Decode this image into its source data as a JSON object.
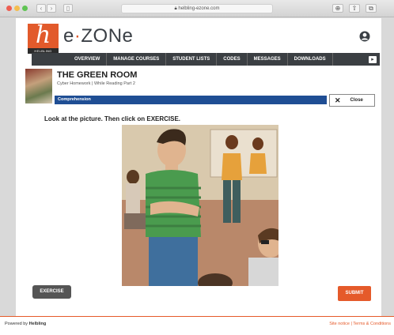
{
  "browser": {
    "url": "helbling-ezone.com",
    "colors": {
      "close": "#ee5e52",
      "minimize": "#f4bd4f",
      "maximize": "#5fc453"
    }
  },
  "header": {
    "logo_letter": "h",
    "logo_sub": "HELBLING",
    "brand_prefix": "e",
    "brand_dot": "·",
    "brand_suffix": "ZONe",
    "user_icon": "user-circle-icon"
  },
  "menu": {
    "items": [
      "OVERVIEW",
      "MANAGE COURSES",
      "STUDENT LISTS",
      "CODES",
      "MESSAGES",
      "DOWNLOADS"
    ]
  },
  "content": {
    "title": "THE GREEN ROOM",
    "subtitle": "Cyber Homework | While Reading Part 2",
    "section": "Comprehension",
    "close_icon": "✕",
    "close_label": "Close",
    "instruction": "Look at the picture. Then click on EXERCISE.",
    "exercise_label": "EXERCISE",
    "submit_label": "SUBMIT"
  },
  "footer": {
    "powered_by": "Powered by",
    "brand": "Helbling",
    "links": "Site notice | Terms & Conditions"
  },
  "colors": {
    "accent": "#e25a2b",
    "section_bar": "#1f4e94",
    "menubar": "#3b3f43"
  }
}
